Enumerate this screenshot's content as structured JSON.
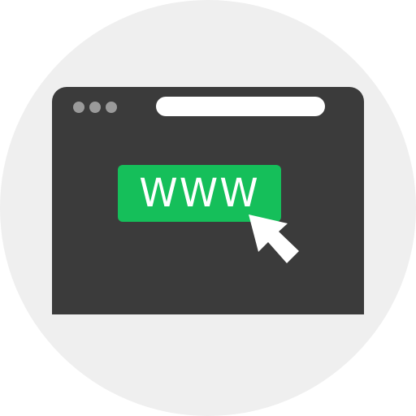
{
  "www_button": {
    "label": "WWW"
  },
  "icons": {
    "window_dots": "window-control-dots",
    "cursor": "mouse-pointer-icon"
  },
  "colors": {
    "background_circle": "#efefef",
    "browser_window": "#3b3b3b",
    "window_dots": "#9a9a9a",
    "address_bar": "#ffffff",
    "www_button": "#15bf5a",
    "cursor_fill": "#ffffff"
  }
}
